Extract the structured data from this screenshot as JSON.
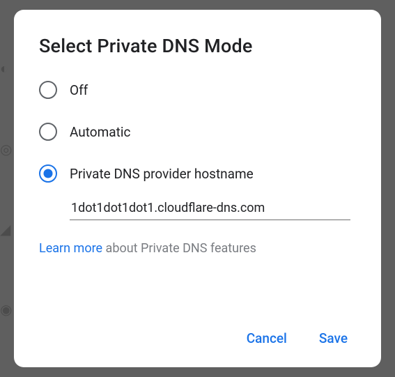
{
  "dialog": {
    "title": "Select Private DNS Mode",
    "options": [
      {
        "label": "Off",
        "selected": false
      },
      {
        "label": "Automatic",
        "selected": false
      },
      {
        "label": "Private DNS provider hostname",
        "selected": true
      }
    ],
    "hostname_value": "1dot1dot1dot1.cloudflare-dns.com",
    "learn_more_link": "Learn more",
    "learn_more_rest": " about Private DNS features",
    "cancel_label": "Cancel",
    "save_label": "Save"
  }
}
